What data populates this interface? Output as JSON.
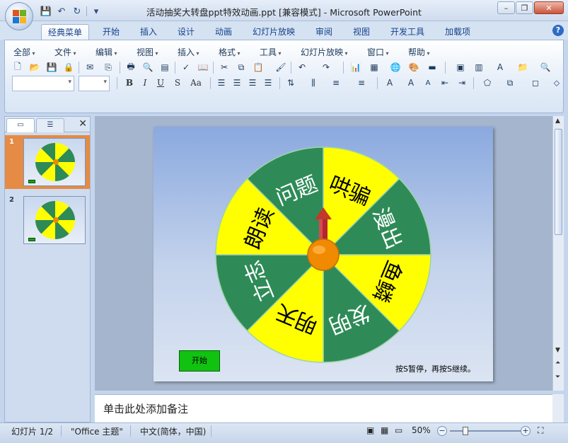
{
  "window": {
    "title": "活动抽奖大转盘ppt特效动画.ppt [兼容模式] - Microsoft PowerPoint"
  },
  "ribbon_tabs": [
    "经典菜单",
    "开始",
    "插入",
    "设计",
    "动画",
    "幻灯片放映",
    "审阅",
    "视图",
    "开发工具",
    "加载项"
  ],
  "active_tab": "经典菜单",
  "classic_menu": [
    "全部",
    "文件",
    "编辑",
    "视图",
    "插入",
    "格式",
    "工具",
    "幻灯片放映",
    "窗口",
    "帮助"
  ],
  "format_buttons": [
    "B",
    "I",
    "U",
    "S",
    "Aa"
  ],
  "slides_panel": {
    "slides": [
      {
        "number": "1",
        "active": true
      },
      {
        "number": "2",
        "active": false
      }
    ]
  },
  "wheel": {
    "segments": [
      "哄骗",
      "漫出",
      "鱼鳞",
      "发明",
      "明天",
      "立志",
      "朗读",
      "问题"
    ],
    "colors": {
      "yellow": "#ffff00",
      "green": "#2e8b57",
      "hub": "#f08a00",
      "arrow": "#c0392b"
    }
  },
  "slide": {
    "start_button": "开始",
    "hint": "按S暂停，再按S继续。"
  },
  "notes": {
    "placeholder": "单击此处添加备注"
  },
  "status": {
    "slide_info": "幻灯片 1/2",
    "theme": "\"Office 主题\"",
    "language": "中文(简体，中国)",
    "zoom": "50%"
  }
}
